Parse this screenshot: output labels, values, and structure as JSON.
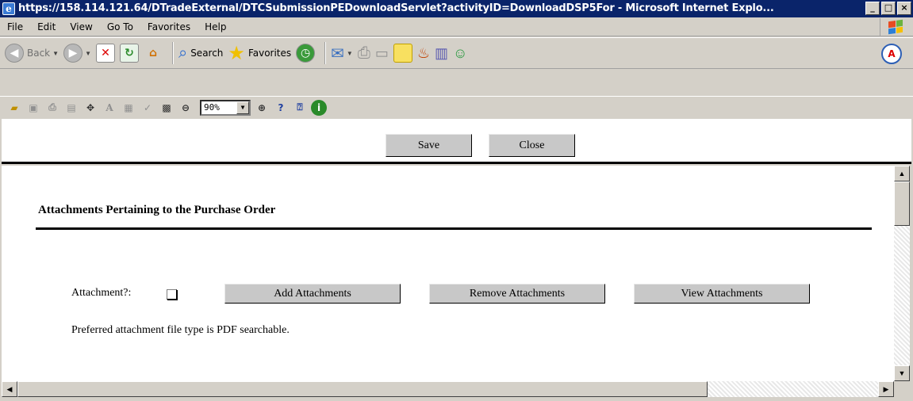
{
  "window": {
    "title": "https://158.114.121.64/DTradeExternal/DTCSubmissionPEDownloadServlet?activityID=DownloadDSP5For - Microsoft Internet Explo...",
    "minimize": "_",
    "maximize": "□",
    "close": "×"
  },
  "menu": {
    "items": [
      "File",
      "Edit",
      "View",
      "Go To",
      "Favorites",
      "Help"
    ]
  },
  "toolbar": {
    "back_label": "Back",
    "search_label": "Search",
    "favorites_label": "Favorites"
  },
  "toolbar2": {
    "zoom_value": "90%"
  },
  "page_header": {
    "save_label": "Save",
    "close_label": "Close"
  },
  "content": {
    "heading": "Attachments Pertaining to the Purchase Order",
    "attachment_label": "Attachment?:",
    "attachment_checked": false,
    "add_attachments_label": "Add Attachments",
    "remove_attachments_label": "Remove Attachments",
    "view_attachments_label": "View Attachments",
    "note": "Preferred attachment file type is PDF searchable."
  },
  "colors": {
    "titlebar": "#0a246a",
    "chrome": "#d4d0c8",
    "button_gray": "#c8c8c8"
  }
}
